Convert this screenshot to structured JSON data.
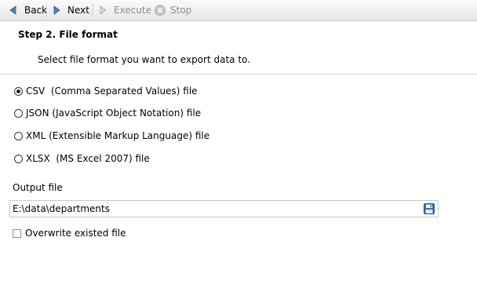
{
  "toolbar": {
    "back_label": "Back",
    "next_label": "Next",
    "execute_label": "Execute",
    "stop_label": "Stop"
  },
  "step": {
    "title": "Step 2. File format",
    "description": "Select file format you want to export data to."
  },
  "formats": [
    {
      "label": "CSV  (Comma Separated Values) file",
      "checked": true
    },
    {
      "label": "JSON (JavaScript Object Notation) file",
      "checked": false
    },
    {
      "label": "XML (Extensible Markup Language) file",
      "checked": false
    },
    {
      "label": "XLSX  (MS Excel 2007) file",
      "checked": false
    }
  ],
  "output": {
    "label": "Output file",
    "value": "E:\\data\\departments"
  },
  "overwrite": {
    "label": "Overwrite existed file",
    "checked": false
  },
  "colors": {
    "nav_arrow": "#4a7fc4",
    "disabled": "#9a9a9a",
    "save_icon": "#2f5f9a"
  }
}
